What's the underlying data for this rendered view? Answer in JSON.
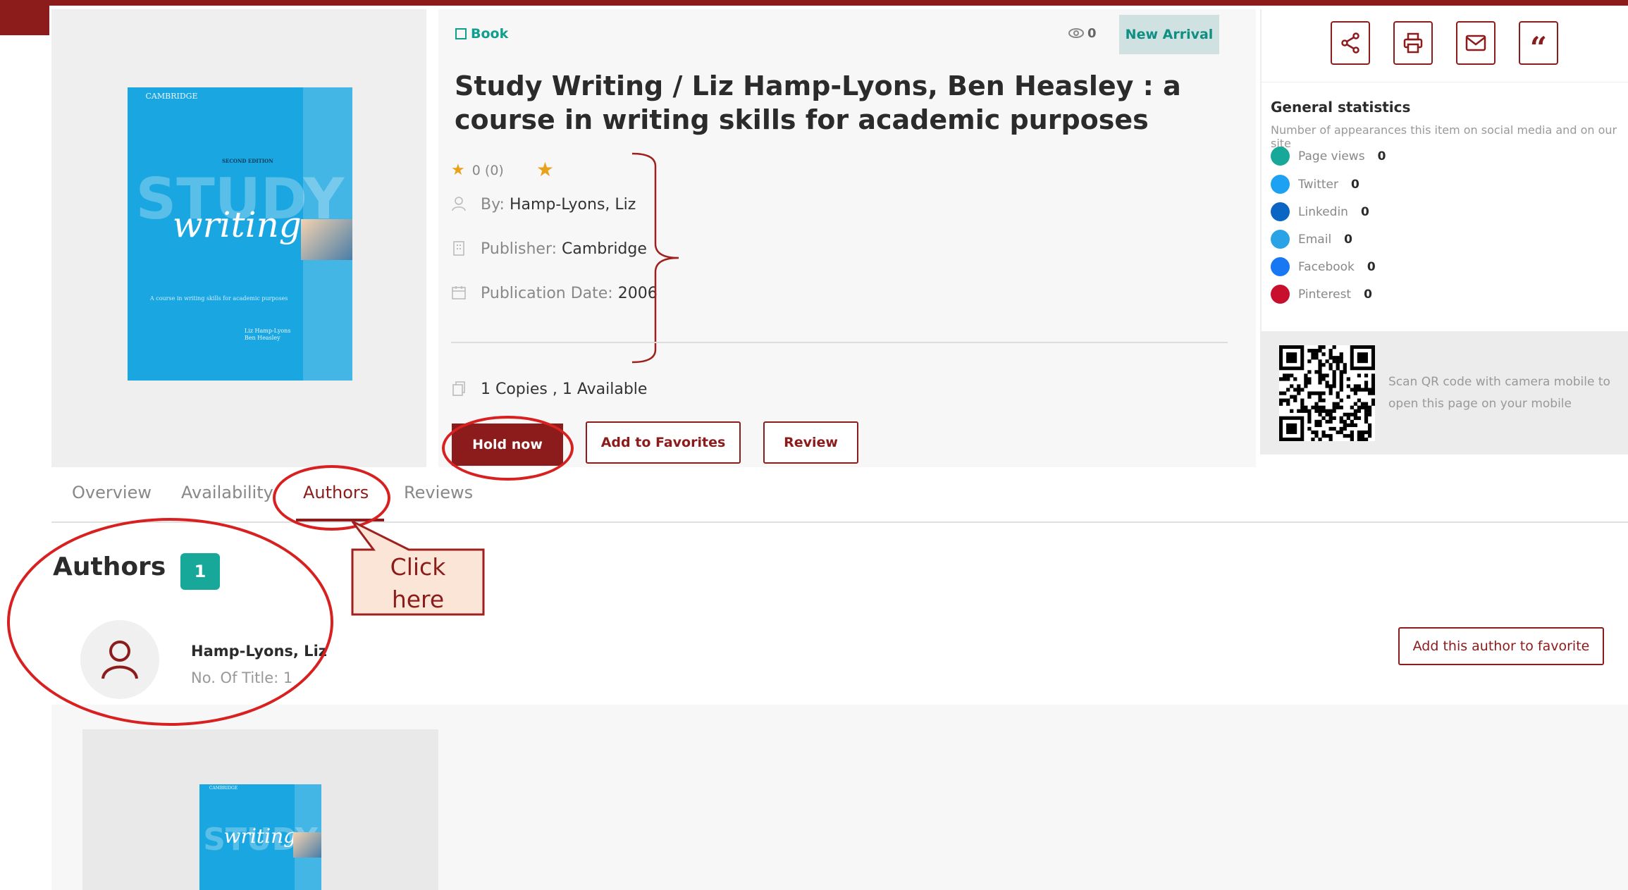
{
  "item": {
    "type_label": "Book",
    "views": "0",
    "badge": "New Arrival",
    "title": "Study Writing / Liz Hamp-Lyons, Ben Heasley : a course in writing skills for academic purposes",
    "rating": "0 (0)",
    "by_label": "By:",
    "by_value": "Hamp-Lyons, Liz",
    "publisher_label": "Publisher:",
    "publisher_value": "Cambridge",
    "date_label": "Publication Date:",
    "date_value": "2006",
    "copies": "1 Copies , 1 Available"
  },
  "cover": {
    "publisher": "CAMBRIDGE",
    "edition": "SECOND EDITION",
    "word1": "STUDY",
    "word2": "writing",
    "subtitle": "A course in writing skills for academic purposes",
    "author1": "Liz Hamp-Lyons",
    "author2": "Ben Heasley"
  },
  "actions": {
    "hold": "Hold now",
    "favorites": "Add to Favorites",
    "review": "Review"
  },
  "tabs": [
    "Overview",
    "Availability",
    "Authors",
    "Reviews"
  ],
  "authors": {
    "heading": "Authors",
    "count": "1",
    "name": "Hamp-Lyons, Liz",
    "titles": "No. Of Title: 1",
    "fav_button": "Add this author to favorite"
  },
  "stats": {
    "title": "General statistics",
    "subtitle": "Number of appearances this item on social media and on our site",
    "rows": [
      {
        "label": "Page views",
        "value": "0",
        "color": "#17a899"
      },
      {
        "label": "Twitter",
        "value": "0",
        "color": "#1da1f2"
      },
      {
        "label": "Linkedin",
        "value": "0",
        "color": "#0a66c2"
      },
      {
        "label": "Email",
        "value": "0",
        "color": "#2aa3e6"
      },
      {
        "label": "Facebook",
        "value": "0",
        "color": "#1877f2"
      },
      {
        "label": "Pinterest",
        "value": "0",
        "color": "#c8102e"
      }
    ]
  },
  "qr": {
    "text": "Scan QR code with camera mobile to open this page on your mobile"
  },
  "annotation": {
    "callout_line1": "Click",
    "callout_line2": "here"
  },
  "colors": {
    "brand": "#8c1c1c",
    "teal": "#17a899",
    "annotation": "#d92020"
  }
}
